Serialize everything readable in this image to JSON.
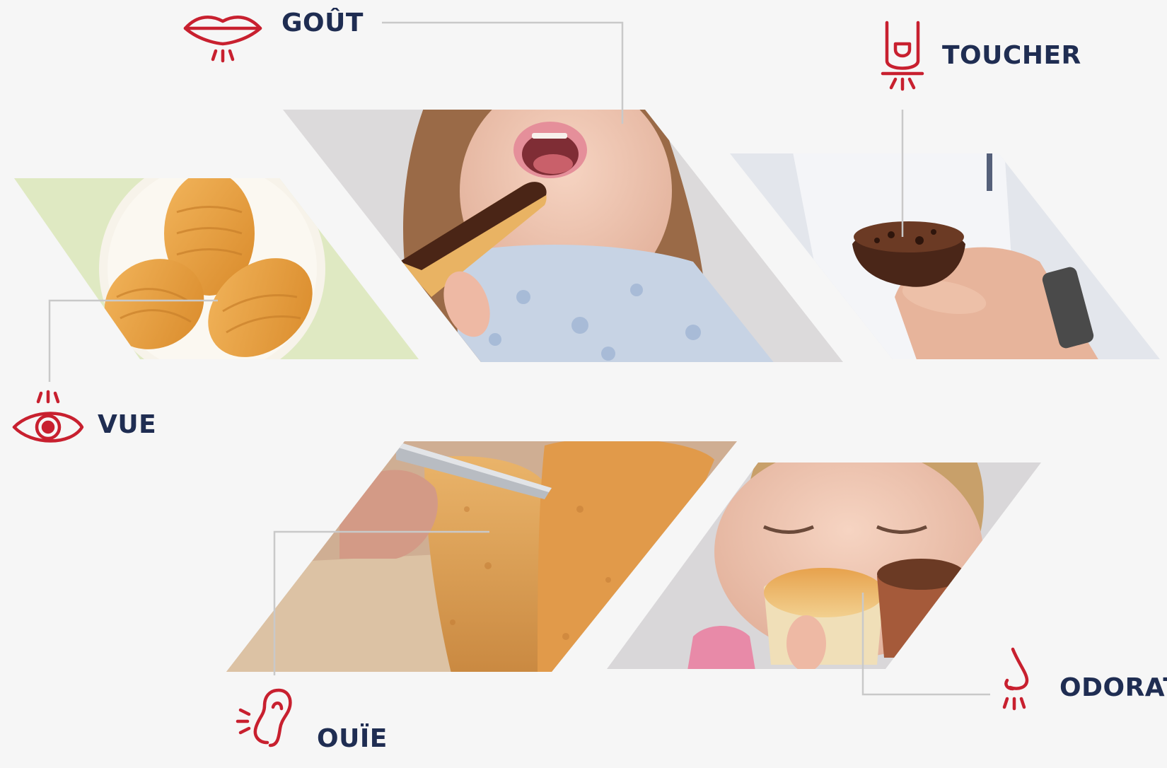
{
  "senses": {
    "gout": {
      "label": "GOÛT",
      "icon": "lips-icon"
    },
    "toucher": {
      "label": "TOUCHER",
      "icon": "finger-touch-icon"
    },
    "vue": {
      "label": "VUE",
      "icon": "eye-icon"
    },
    "ouie": {
      "label": "OUÏE",
      "icon": "ear-icon"
    },
    "odorat": {
      "label": "ODORAT",
      "icon": "nose-icon"
    }
  },
  "colors": {
    "accent": "#c8202f",
    "label": "#1f2d52",
    "connector": "#c9c9c9",
    "background": "#f6f6f6"
  },
  "photos": {
    "vue": "madeleines-photo",
    "gout": "child-eating-eclair-photo",
    "toucher": "hand-holding-chocolate-cake-photo",
    "ouie": "knife-cutting-cake-photo",
    "odorat": "child-smelling-muffins-photo"
  }
}
